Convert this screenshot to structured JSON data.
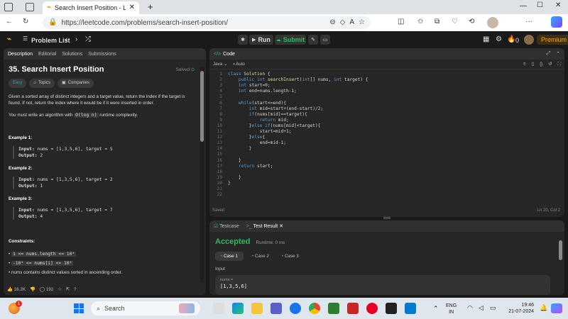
{
  "browser": {
    "tab_title": "Search Insert Position - LeetCode",
    "url": "https://leetcode.com/problems/search-insert-position/"
  },
  "toolbar": {
    "problem_list": "Problem List",
    "run": "Run",
    "submit": "Submit",
    "streak": "0",
    "premium": "Premium"
  },
  "left": {
    "tabs": [
      "Description",
      "Editorial",
      "Solutions",
      "Submissions"
    ],
    "title": "35. Search Insert Position",
    "solved": "Solved",
    "difficulty": "Easy",
    "topics": "Topics",
    "companies": "Companies",
    "desc1": "Given a sorted array of distinct integers and a target value, return the index if the target is found. If not, return the index where it would be if it were inserted in order.",
    "desc2_pre": "You must write an algorithm with ",
    "desc2_code": "O(log n)",
    "desc2_post": " runtime complexity.",
    "examples": [
      {
        "label": "Example 1:",
        "input": "nums = [1,3,5,6], target = 5",
        "output": "2"
      },
      {
        "label": "Example 2:",
        "input": "nums = [1,3,5,6], target = 2",
        "output": "1"
      },
      {
        "label": "Example 3:",
        "input": "nums = [1,3,5,6], target = 7",
        "output": "4"
      }
    ],
    "input_label": "Input:",
    "output_label": "Output:",
    "constraints_label": "Constraints:",
    "constraints": [
      "1 <= nums.length <= 10⁴",
      "-10⁴ <= nums[i] <= 10⁴",
      "nums contains distinct values sorted in ascending order."
    ],
    "likes": "16.2K",
    "comments": "192"
  },
  "code": {
    "title": "Code",
    "lang": "Java",
    "auto": "Auto",
    "saved": "Saved",
    "cursor": "Ln 20, Col 2",
    "lines": [
      "class Solution {",
      "    public int searchInsert(int[] nums, int target) {",
      "    int start=0;",
      "    int end=nums.length-1;",
      "",
      "    while(start<=end){",
      "        int mid=start+(end-start)/2;",
      "        if(nums[mid]==target){",
      "            return mid;",
      "        }else if(nums[mid]<target){",
      "            start=mid+1;",
      "        }else{",
      "            end=mid-1;",
      "        }",
      "",
      "    }",
      "    return start;",
      "",
      "    }",
      "}",
      "",
      ""
    ]
  },
  "result": {
    "tabs": [
      "Testcase",
      "Test Result"
    ],
    "accepted": "Accepted",
    "runtime": "Runtime: 0 ms",
    "cases": [
      "Case 1",
      "Case 2",
      "Case 3"
    ],
    "input_label": "Input",
    "param": "nums =",
    "value": "[1,3,5,6]"
  },
  "taskbar": {
    "search": "Search",
    "lang1": "ENG",
    "lang2": "IN",
    "time": "19:46",
    "date": "21-07-2024",
    "notif": "1"
  },
  "colors": {
    "accent": "#ffa116",
    "green": "#2cbb5d",
    "blue": "#0a84ff"
  }
}
